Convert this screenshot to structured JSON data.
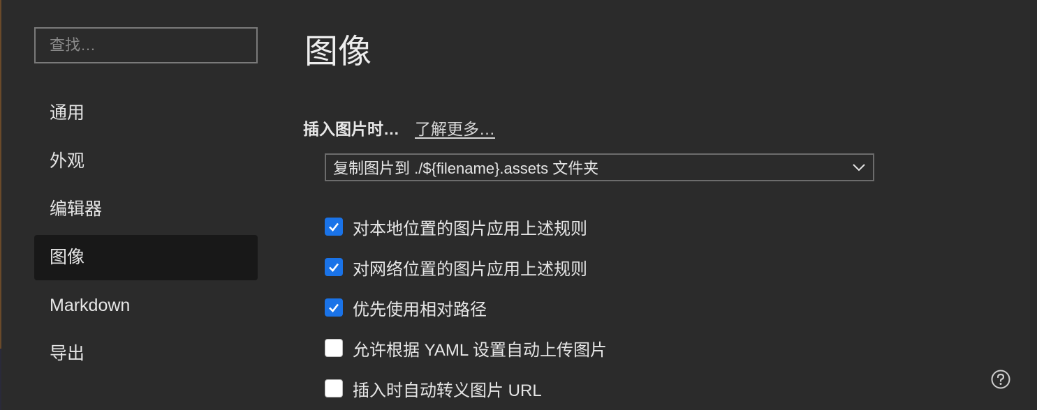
{
  "sidebar": {
    "search_placeholder": "查找…",
    "items": [
      {
        "label": "通用",
        "active": false
      },
      {
        "label": "外观",
        "active": false
      },
      {
        "label": "编辑器",
        "active": false
      },
      {
        "label": "图像",
        "active": true
      },
      {
        "label": "Markdown",
        "active": false
      },
      {
        "label": "导出",
        "active": false
      }
    ]
  },
  "main": {
    "title": "图像",
    "insert_label": "插入图片时…",
    "learn_more": "了解更多…",
    "select_value": "复制图片到 ./${filename}.assets 文件夹",
    "options": [
      {
        "label": "对本地位置的图片应用上述规则",
        "checked": true
      },
      {
        "label": "对网络位置的图片应用上述规则",
        "checked": true
      },
      {
        "label": "优先使用相对路径",
        "checked": true
      },
      {
        "label": "允许根据 YAML 设置自动上传图片",
        "checked": false
      },
      {
        "label": "插入时自动转义图片 URL",
        "checked": false
      }
    ]
  },
  "colors": {
    "background": "#2b2b2b",
    "active_nav": "#181818",
    "checkbox_accent": "#1a73e8"
  },
  "icons": {
    "select_arrow": "chevron-down-icon",
    "checkmark": "check-icon",
    "help": "help-icon"
  }
}
